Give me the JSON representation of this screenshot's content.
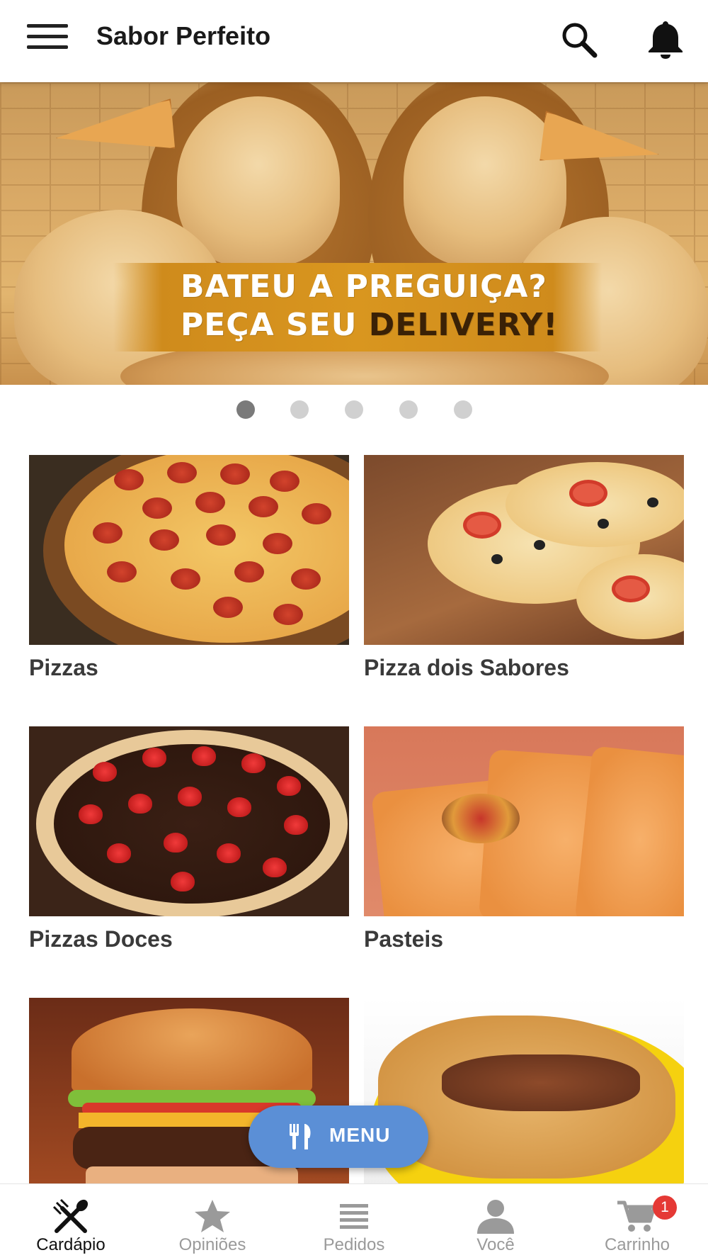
{
  "app": {
    "title": "Sabor Perfeito",
    "menu_icon": "hamburger-menu-icon",
    "search_icon": "search-icon",
    "notification_icon": "bell-icon"
  },
  "banner": {
    "line1": "BATEU A PREGUIÇA?",
    "line2_prefix": "PEÇA SEU ",
    "line2_highlight": "DELIVERY!",
    "slides_total": 5,
    "active_slide": 1
  },
  "categories": [
    {
      "label": "Pizzas"
    },
    {
      "label": "Pizza dois Sabores"
    },
    {
      "label": "Pizzas Doces"
    },
    {
      "label": "Pasteis"
    },
    {
      "label": ""
    },
    {
      "label": ""
    }
  ],
  "fab": {
    "label": "MENU",
    "icon": "fork-knife-icon",
    "color": "#5b8fd6"
  },
  "bottom_nav": {
    "items": [
      {
        "label": "Cardápio",
        "icon": "utensils-icon",
        "active": true
      },
      {
        "label": "Opiniões",
        "icon": "star-icon",
        "active": false
      },
      {
        "label": "Pedidos",
        "icon": "list-icon",
        "active": false
      },
      {
        "label": "Você",
        "icon": "person-icon",
        "active": false
      },
      {
        "label": "Carrinho",
        "icon": "cart-icon",
        "active": false,
        "badge": "1"
      }
    ]
  },
  "colors": {
    "accent": "#5b8fd6",
    "badge": "#e53935",
    "active_dot": "#7a7a7a",
    "inactive_dot": "#d0d0d0"
  }
}
